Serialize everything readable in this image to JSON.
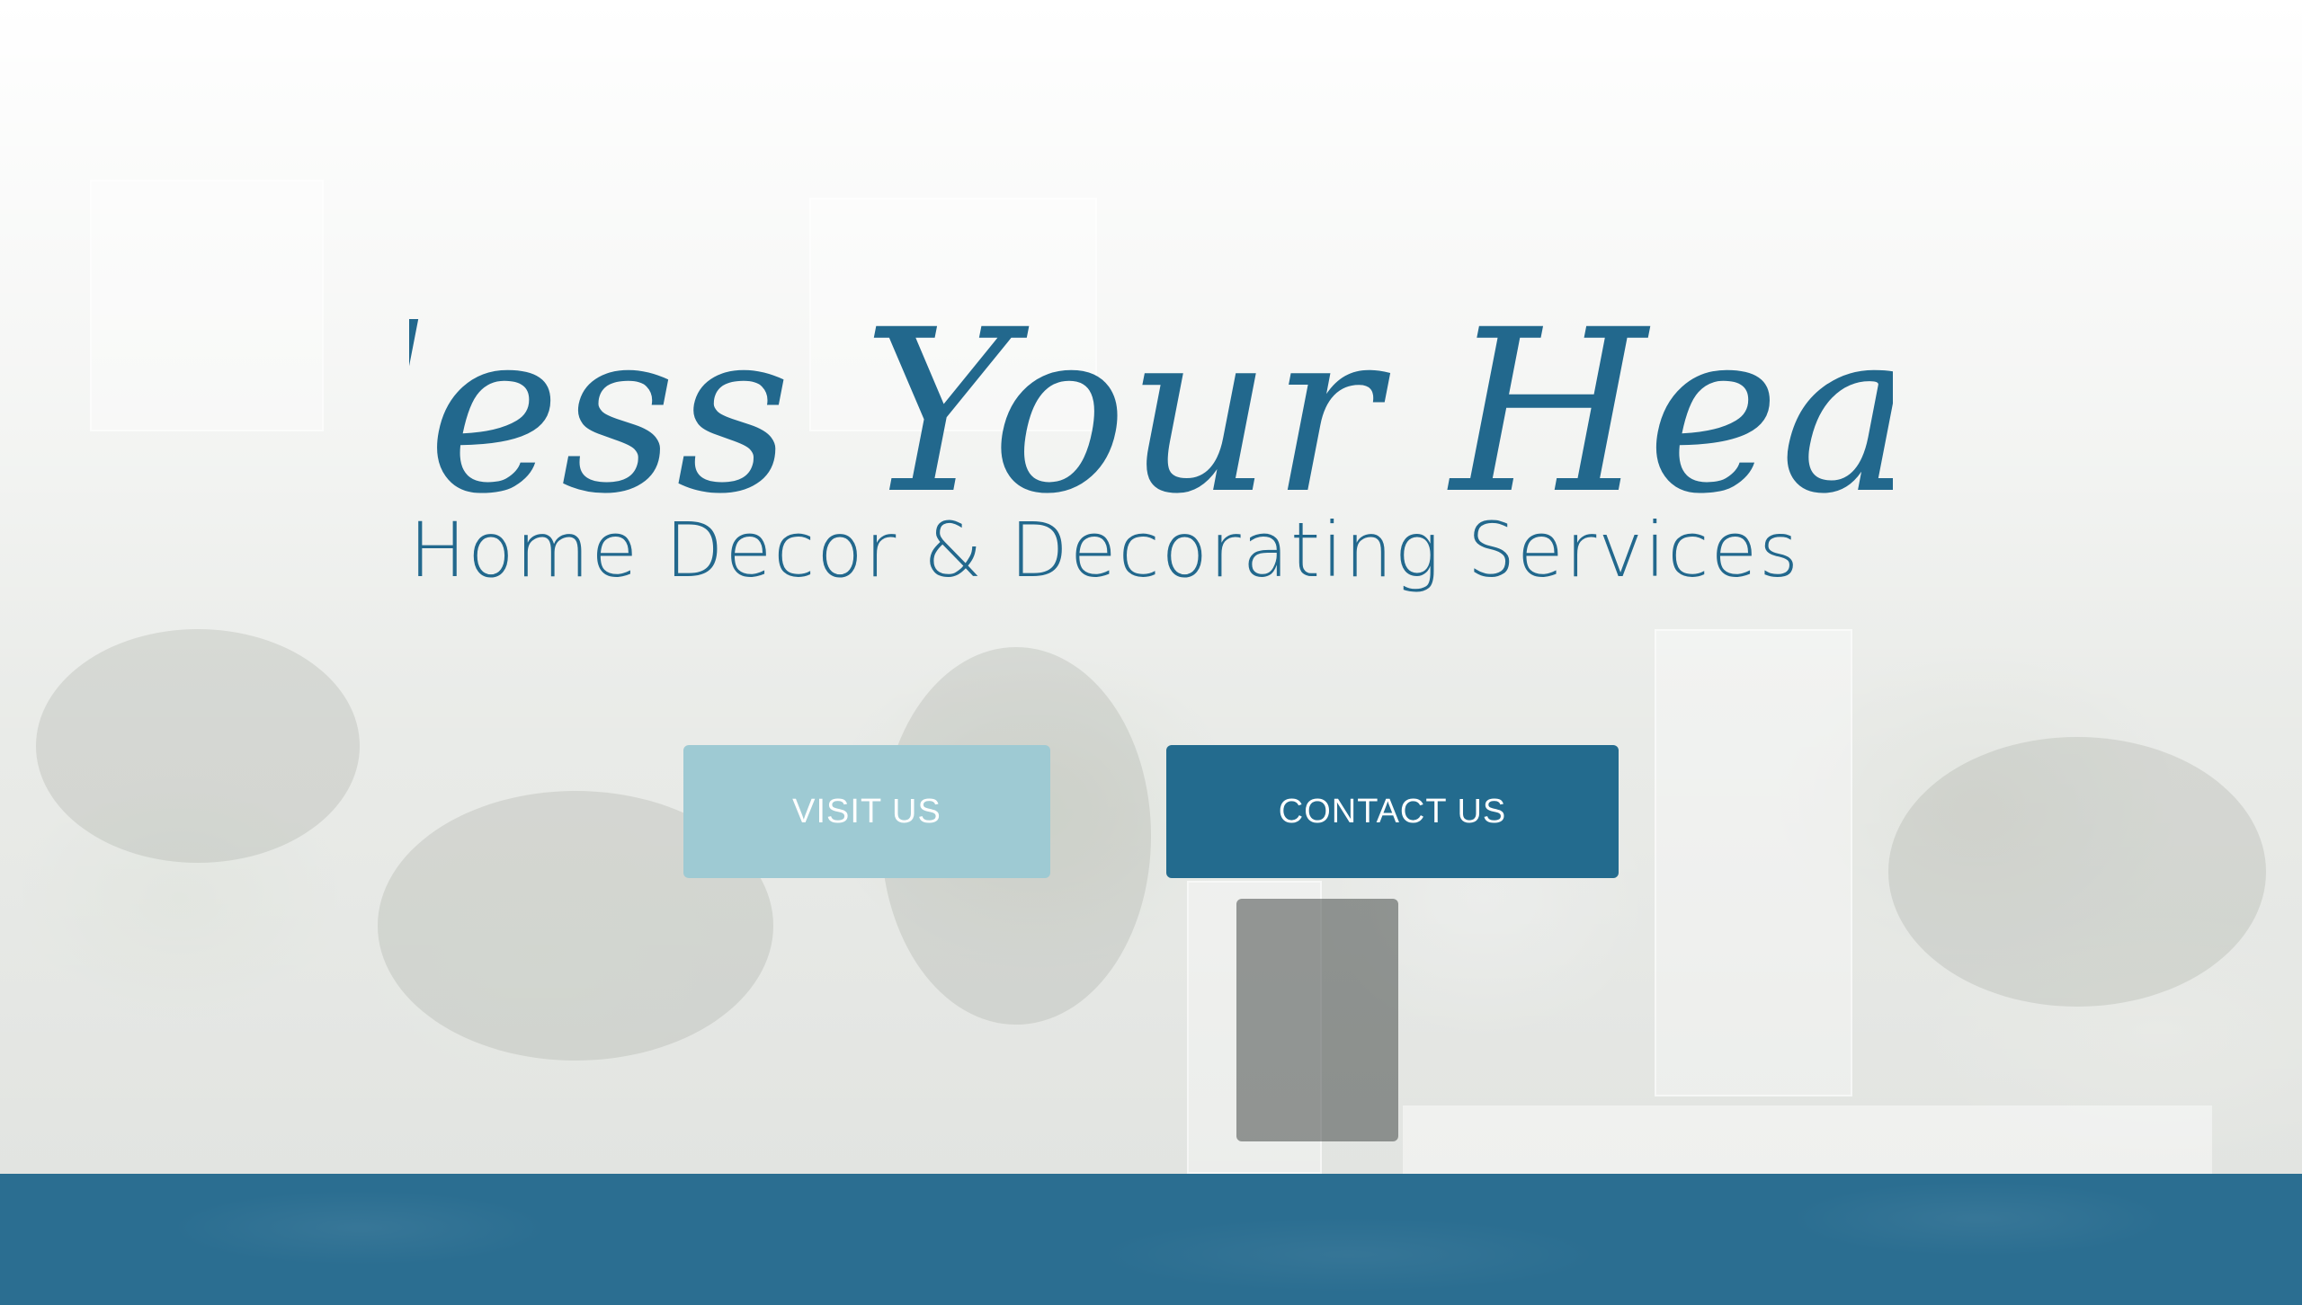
{
  "brand": {
    "script_title": "Bless Your Heart",
    "subtitle": "Home Decor & Decorating Services"
  },
  "actions": {
    "visit_label": "VISIT US",
    "contact_label": "CONTACT US"
  },
  "colors": {
    "brand_blue": "#22688d",
    "visit_button": "#9ecad3",
    "contact_button": "#236b8e",
    "footer_band": "#2b6e91"
  }
}
